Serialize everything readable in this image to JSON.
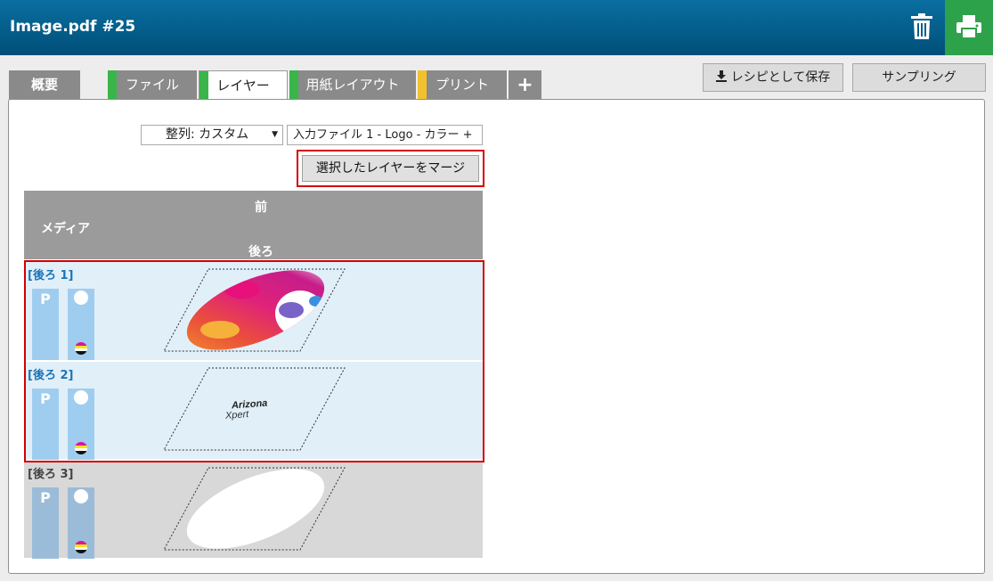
{
  "header": {
    "title": "Image.pdf #25",
    "delete_icon": "trash-icon",
    "print_icon": "printer-icon"
  },
  "tabs": [
    {
      "label": "概要",
      "stripe": ""
    },
    {
      "label": "ファイル",
      "stripe": "#39b54a"
    },
    {
      "label": "レイヤー",
      "stripe": "#39b54a"
    },
    {
      "label": "用紙レイアウト",
      "stripe": "#39b54a"
    },
    {
      "label": "プリント",
      "stripe": "#f2c12e"
    },
    {
      "label": "+",
      "stripe": ""
    }
  ],
  "toolbar": {
    "save_recipe": "レシピとして保存",
    "sampling": "サンプリング"
  },
  "controls": {
    "sort": "整列: カスタム",
    "input_file": "入力ファイル 1 - Logo - カラー +",
    "merge": "選択したレイヤーをマージ"
  },
  "media_header": {
    "front": "前",
    "media": "メディア",
    "back": "後ろ"
  },
  "layers": [
    {
      "label": "[後ろ 1]",
      "p": "P",
      "selected": true,
      "content": "color splash image"
    },
    {
      "label": "[後ろ 2]",
      "p": "P",
      "selected": true,
      "content": "Arizona Xpert",
      "logo_line1": "Arizona",
      "logo_line2": "Xpert"
    },
    {
      "label": "[後ろ 3]",
      "p": "P",
      "selected": false,
      "content": "white ellipse"
    }
  ],
  "colors": {
    "header": "#004f78",
    "print": "#2ea24a",
    "selected_row": "#e1eff9",
    "highlight": "#d40000"
  }
}
